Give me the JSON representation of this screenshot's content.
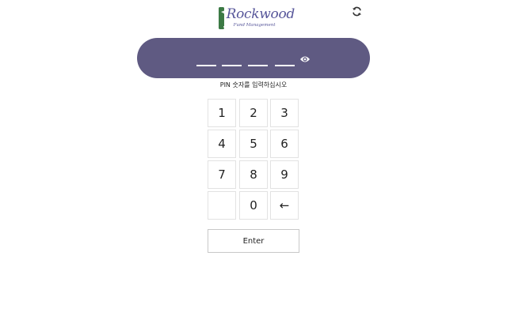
{
  "logo": {
    "name": "Rockwood",
    "subtitle": "Fund Management",
    "mark_icon": "tree-icon",
    "brand_green": "#3c7a45",
    "brand_purple": "#57569a"
  },
  "header": {
    "refresh_icon": "refresh-icon"
  },
  "pin": {
    "bar_color": "#5f5a82",
    "slots": 4,
    "toggle_icon": "eye-icon",
    "prompt": "PIN 숫자를 입력하십시오"
  },
  "keypad": {
    "keys": [
      "1",
      "2",
      "3",
      "4",
      "5",
      "6",
      "7",
      "8",
      "9",
      "",
      "0",
      "←"
    ],
    "enter_label": "Enter"
  }
}
